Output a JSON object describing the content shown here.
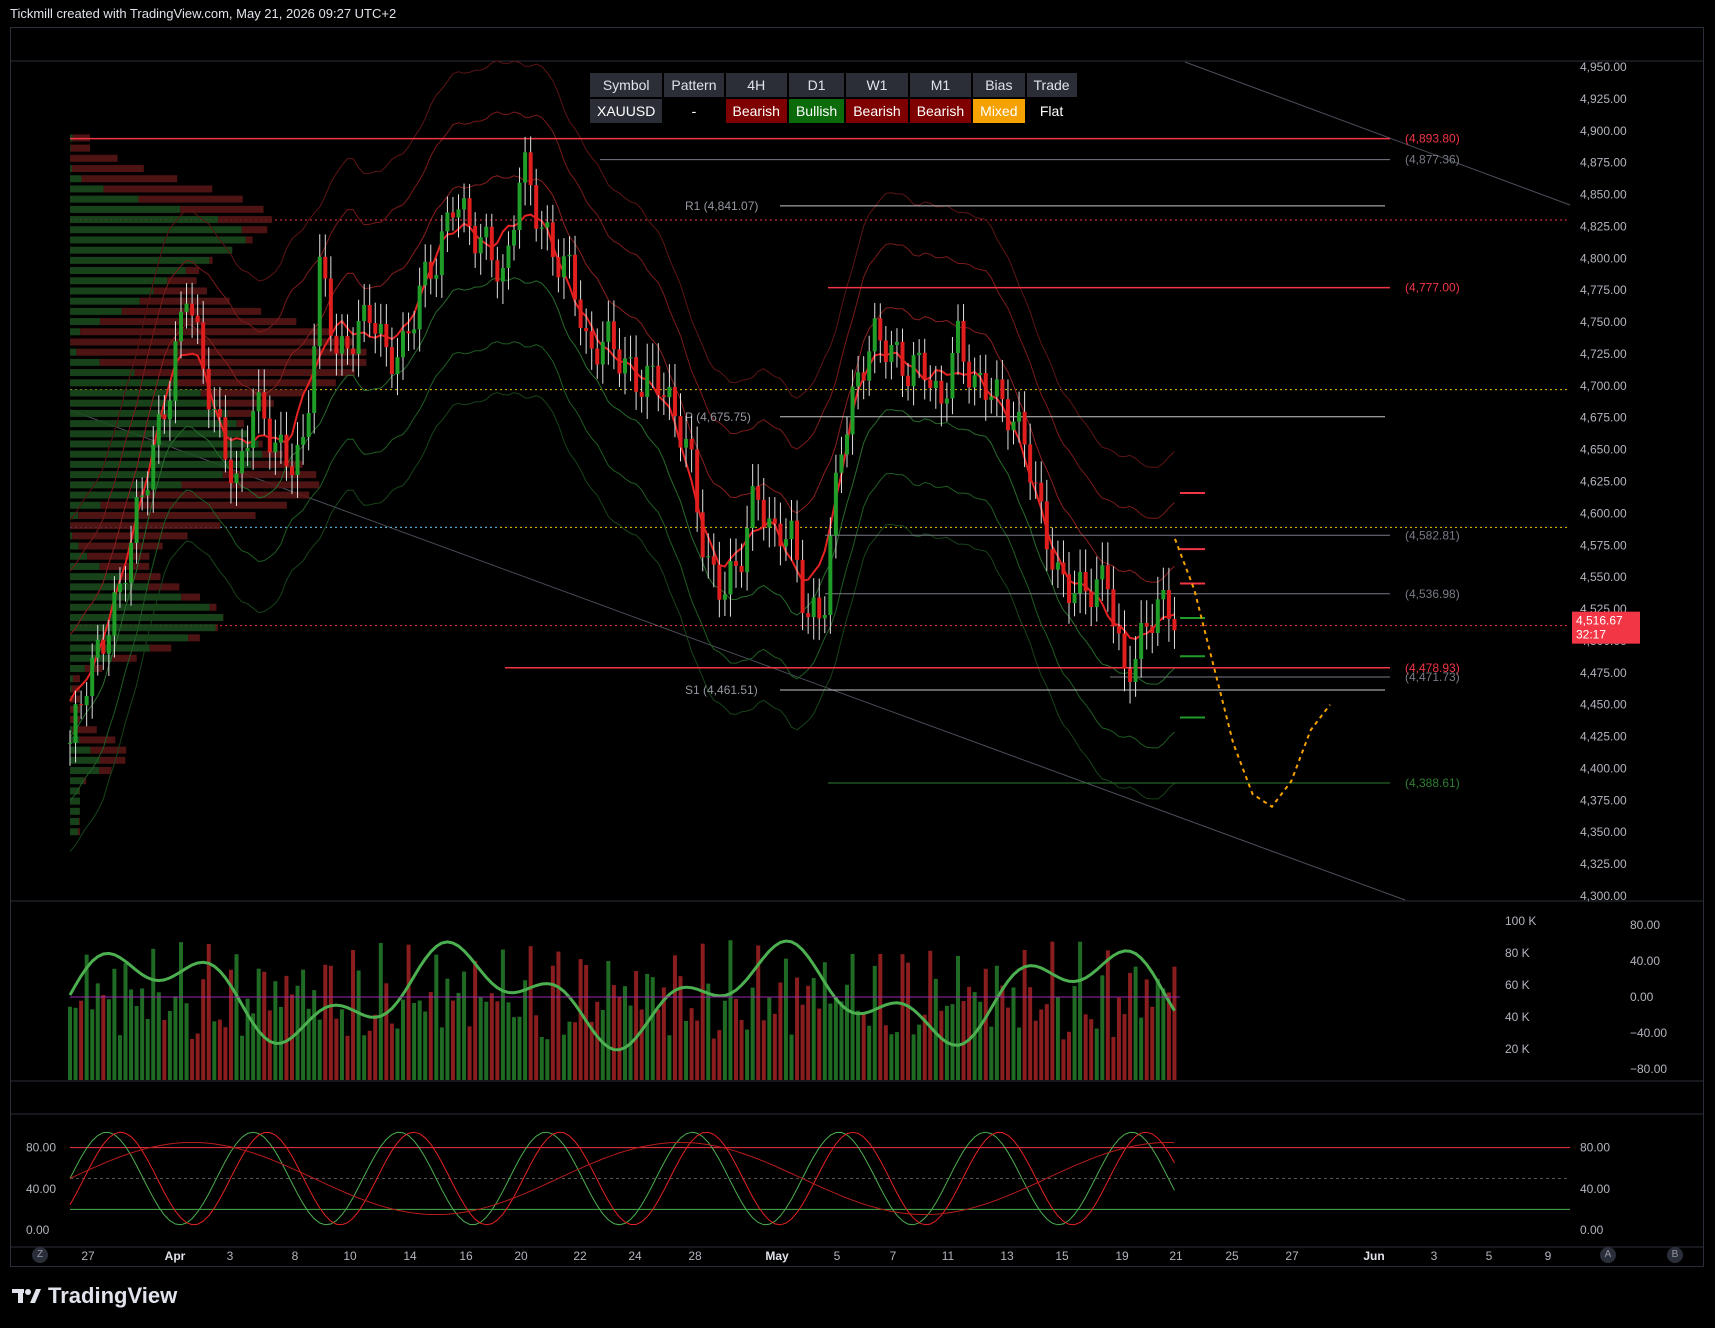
{
  "header": {
    "caption": "Tickmill created with TradingView.com, May 21, 2026 09:27 UTC+2"
  },
  "brand": {
    "name": "TradingView"
  },
  "colors": {
    "bull": "#2e7d32",
    "bear": "#d32f2f",
    "accent_red": "#f23645",
    "mixed": "#f5a100",
    "bg": "#000000"
  },
  "table": {
    "headers": [
      "Symbol",
      "Pattern",
      "4H",
      "D1",
      "W1",
      "M1",
      "Bias",
      "Trade"
    ],
    "row": [
      {
        "text": "XAUUSD",
        "bg": "#2b2e36"
      },
      {
        "text": "-",
        "bg": "#000000"
      },
      {
        "text": "Bearish",
        "bg": "#7f0000"
      },
      {
        "text": "Bullish",
        "bg": "#0b6b0b"
      },
      {
        "text": "Bearish",
        "bg": "#7f0000"
      },
      {
        "text": "Bearish",
        "bg": "#7f0000"
      },
      {
        "text": "Mixed",
        "bg": "#f5a100"
      },
      {
        "text": "Flat",
        "bg": "#000000"
      }
    ]
  },
  "chart_data": [
    {
      "type": "candlestick",
      "symbol": "XAUUSD",
      "ylim": [
        4300,
        4950
      ],
      "y_ticks": [
        "4,950.00",
        "4,925.00",
        "4,900.00",
        "4,875.00",
        "4,850.00",
        "4,825.00",
        "4,800.00",
        "4,775.00",
        "4,750.00",
        "4,725.00",
        "4,700.00",
        "4,675.00",
        "4,650.00",
        "4,625.00",
        "4,600.00",
        "4,575.00",
        "4,550.00",
        "4,525.00",
        "4,500.00",
        "4,475.00",
        "4,450.00",
        "4,425.00",
        "4,400.00",
        "4,375.00",
        "4,350.00",
        "4,325.00",
        "4,300.00"
      ],
      "x_ticks": [
        "27",
        "Apr",
        "3",
        "8",
        "10",
        "14",
        "16",
        "20",
        "22",
        "24",
        "28",
        "May",
        "5",
        "7",
        "11",
        "13",
        "15",
        "19",
        "21",
        "25",
        "27",
        "Jun",
        "3",
        "5",
        "9"
      ],
      "price_path": [
        4420,
        4470,
        4500,
        4540,
        4600,
        4650,
        4700,
        4780,
        4710,
        4660,
        4620,
        4690,
        4660,
        4640,
        4650,
        4800,
        4720,
        4740,
        4760,
        4720,
        4730,
        4780,
        4800,
        4850,
        4820,
        4810,
        4780,
        4880,
        4830,
        4800,
        4790,
        4720,
        4740,
        4720,
        4700,
        4710,
        4680,
        4650,
        4560,
        4540,
        4560,
        4620,
        4580,
        4590,
        4520,
        4520,
        4650,
        4700,
        4740,
        4730,
        4710,
        4720,
        4680,
        4740,
        4700,
        4700,
        4680,
        4660,
        4600,
        4550,
        4540,
        4540,
        4550,
        4470,
        4500,
        4530,
        4520
      ],
      "current_price": {
        "label": "4,516.67",
        "countdown": "32:17",
        "value": 4516.67
      },
      "levels": [
        {
          "label": "(4,893.80)",
          "value": 4893.8,
          "color": "#f23645"
        },
        {
          "label": "(4,877.36)",
          "value": 4877.36,
          "color": "#787b86"
        },
        {
          "label": "R1 (4,841.07)",
          "value": 4841.07,
          "color": "#9598a1"
        },
        {
          "label": "(4,777.00)",
          "value": 4777.0,
          "color": "#f23645"
        },
        {
          "label": "P (4,675.75)",
          "value": 4675.75,
          "color": "#9598a1"
        },
        {
          "label": "(4,582.81)",
          "value": 4582.81,
          "color": "#787b86"
        },
        {
          "label": "(4,536.98)",
          "value": 4536.98,
          "color": "#787b86"
        },
        {
          "label": "(4,478.93)",
          "value": 4478.93,
          "color": "#f23645"
        },
        {
          "label": "(4,471.73)",
          "value": 4471.73,
          "color": "#787b86"
        },
        {
          "label": "S1 (4,461.51)",
          "value": 4461.51,
          "color": "#9598a1"
        },
        {
          "label": "(4,388.61)",
          "value": 4388.61,
          "color": "#2e7d32"
        }
      ],
      "projection": [
        4580,
        4540,
        4480,
        4420,
        4380,
        4370,
        4390,
        4430,
        4450
      ]
    },
    {
      "type": "bar",
      "name": "volume",
      "y_ticks_left": [
        "100 K",
        "80 K",
        "60 K",
        "40 K",
        "20 K"
      ],
      "y_ticks_right": [
        "80.00",
        "40.00",
        "0.00",
        "−40.00",
        "−80.00"
      ]
    },
    {
      "type": "line",
      "name": "stochastic",
      "y_ticks": [
        "80.00",
        "40.00",
        "0.00"
      ]
    }
  ]
}
